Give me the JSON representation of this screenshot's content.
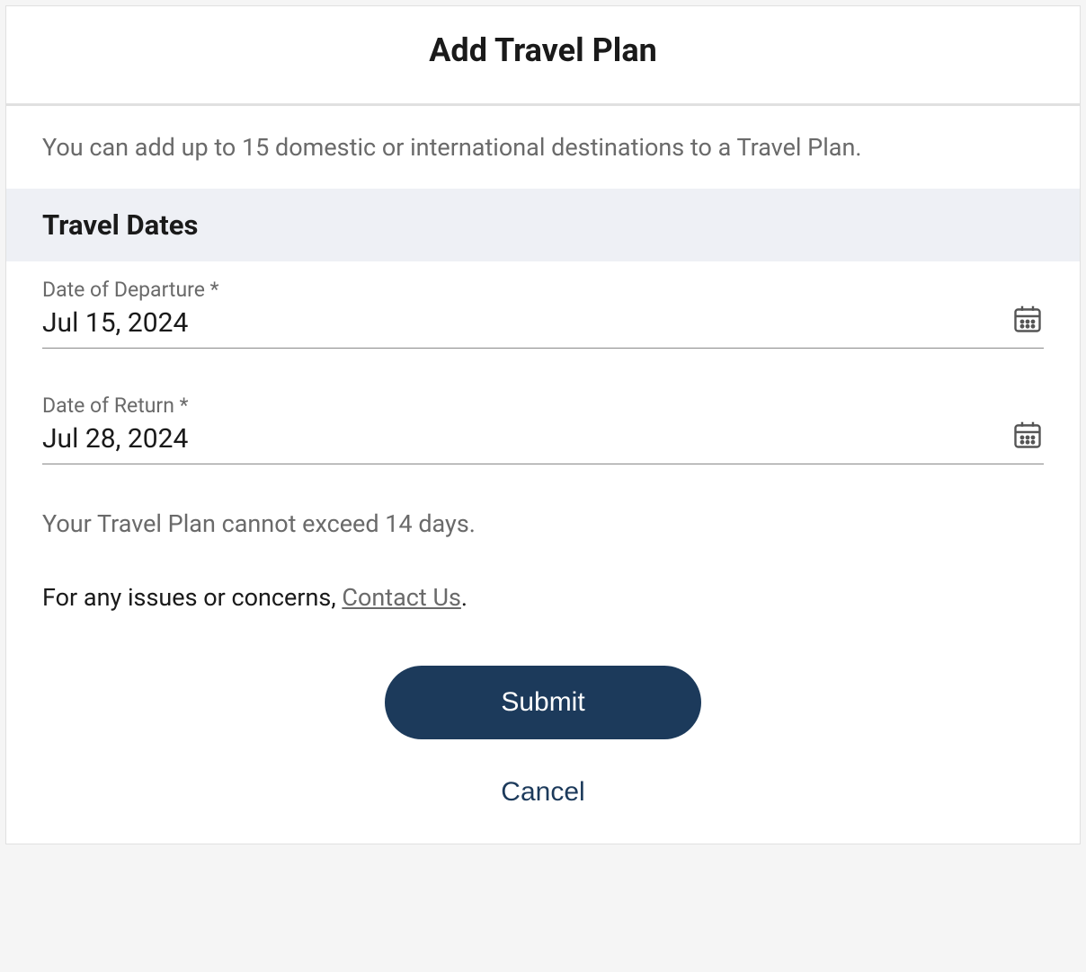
{
  "header": {
    "title": "Add Travel Plan"
  },
  "intro": "You can add up to 15 domestic or international destinations to a Travel Plan.",
  "section": {
    "title": "Travel Dates"
  },
  "fields": {
    "departure": {
      "label": "Date of Departure *",
      "value": "Jul 15, 2024"
    },
    "return": {
      "label": "Date of Return *",
      "value": "Jul 28, 2024"
    }
  },
  "note": "Your Travel Plan cannot exceed 14 days.",
  "contact": {
    "prefix": "For any issues or concerns, ",
    "link": "Contact Us",
    "suffix": "."
  },
  "actions": {
    "submit": "Submit",
    "cancel": "Cancel"
  }
}
